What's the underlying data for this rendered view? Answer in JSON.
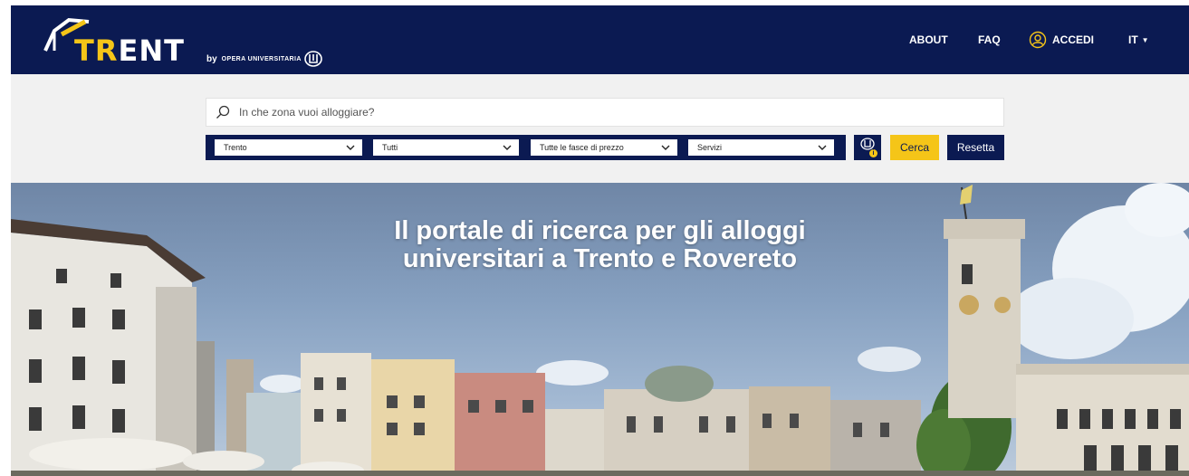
{
  "brand": {
    "logo_text": "TRENT",
    "logo_accent": "TR",
    "logo_rest": "ENT",
    "by_label": "by",
    "partner": "OPERA UNIVERSITARIA",
    "icon": "opera-universitaria-logo-icon"
  },
  "nav": {
    "about": "ABOUT",
    "faq": "FAQ",
    "login": "ACCEDI",
    "login_icon": "user-circle-icon",
    "language": "IT",
    "language_icon": "caret-down-icon"
  },
  "search": {
    "placeholder": "In che zona vuoi alloggiare?",
    "value": "",
    "icon": "search-icon"
  },
  "filters": {
    "city": "Trento",
    "type": "Tutti",
    "price": "Tutte le fasce di prezzo",
    "services": "Servizi",
    "chevron_icon": "chevron-down-icon"
  },
  "buttons": {
    "info_icon": "opera-info-icon",
    "search": "Cerca",
    "reset": "Resetta"
  },
  "hero": {
    "title_line1": "Il portale di ricerca per gli alloggi",
    "title_line2": "universitari a Trento e Rovereto"
  },
  "colors": {
    "navy": "#0b1a52",
    "yellow": "#f5c518",
    "search_bg": "#f1f1f1"
  }
}
